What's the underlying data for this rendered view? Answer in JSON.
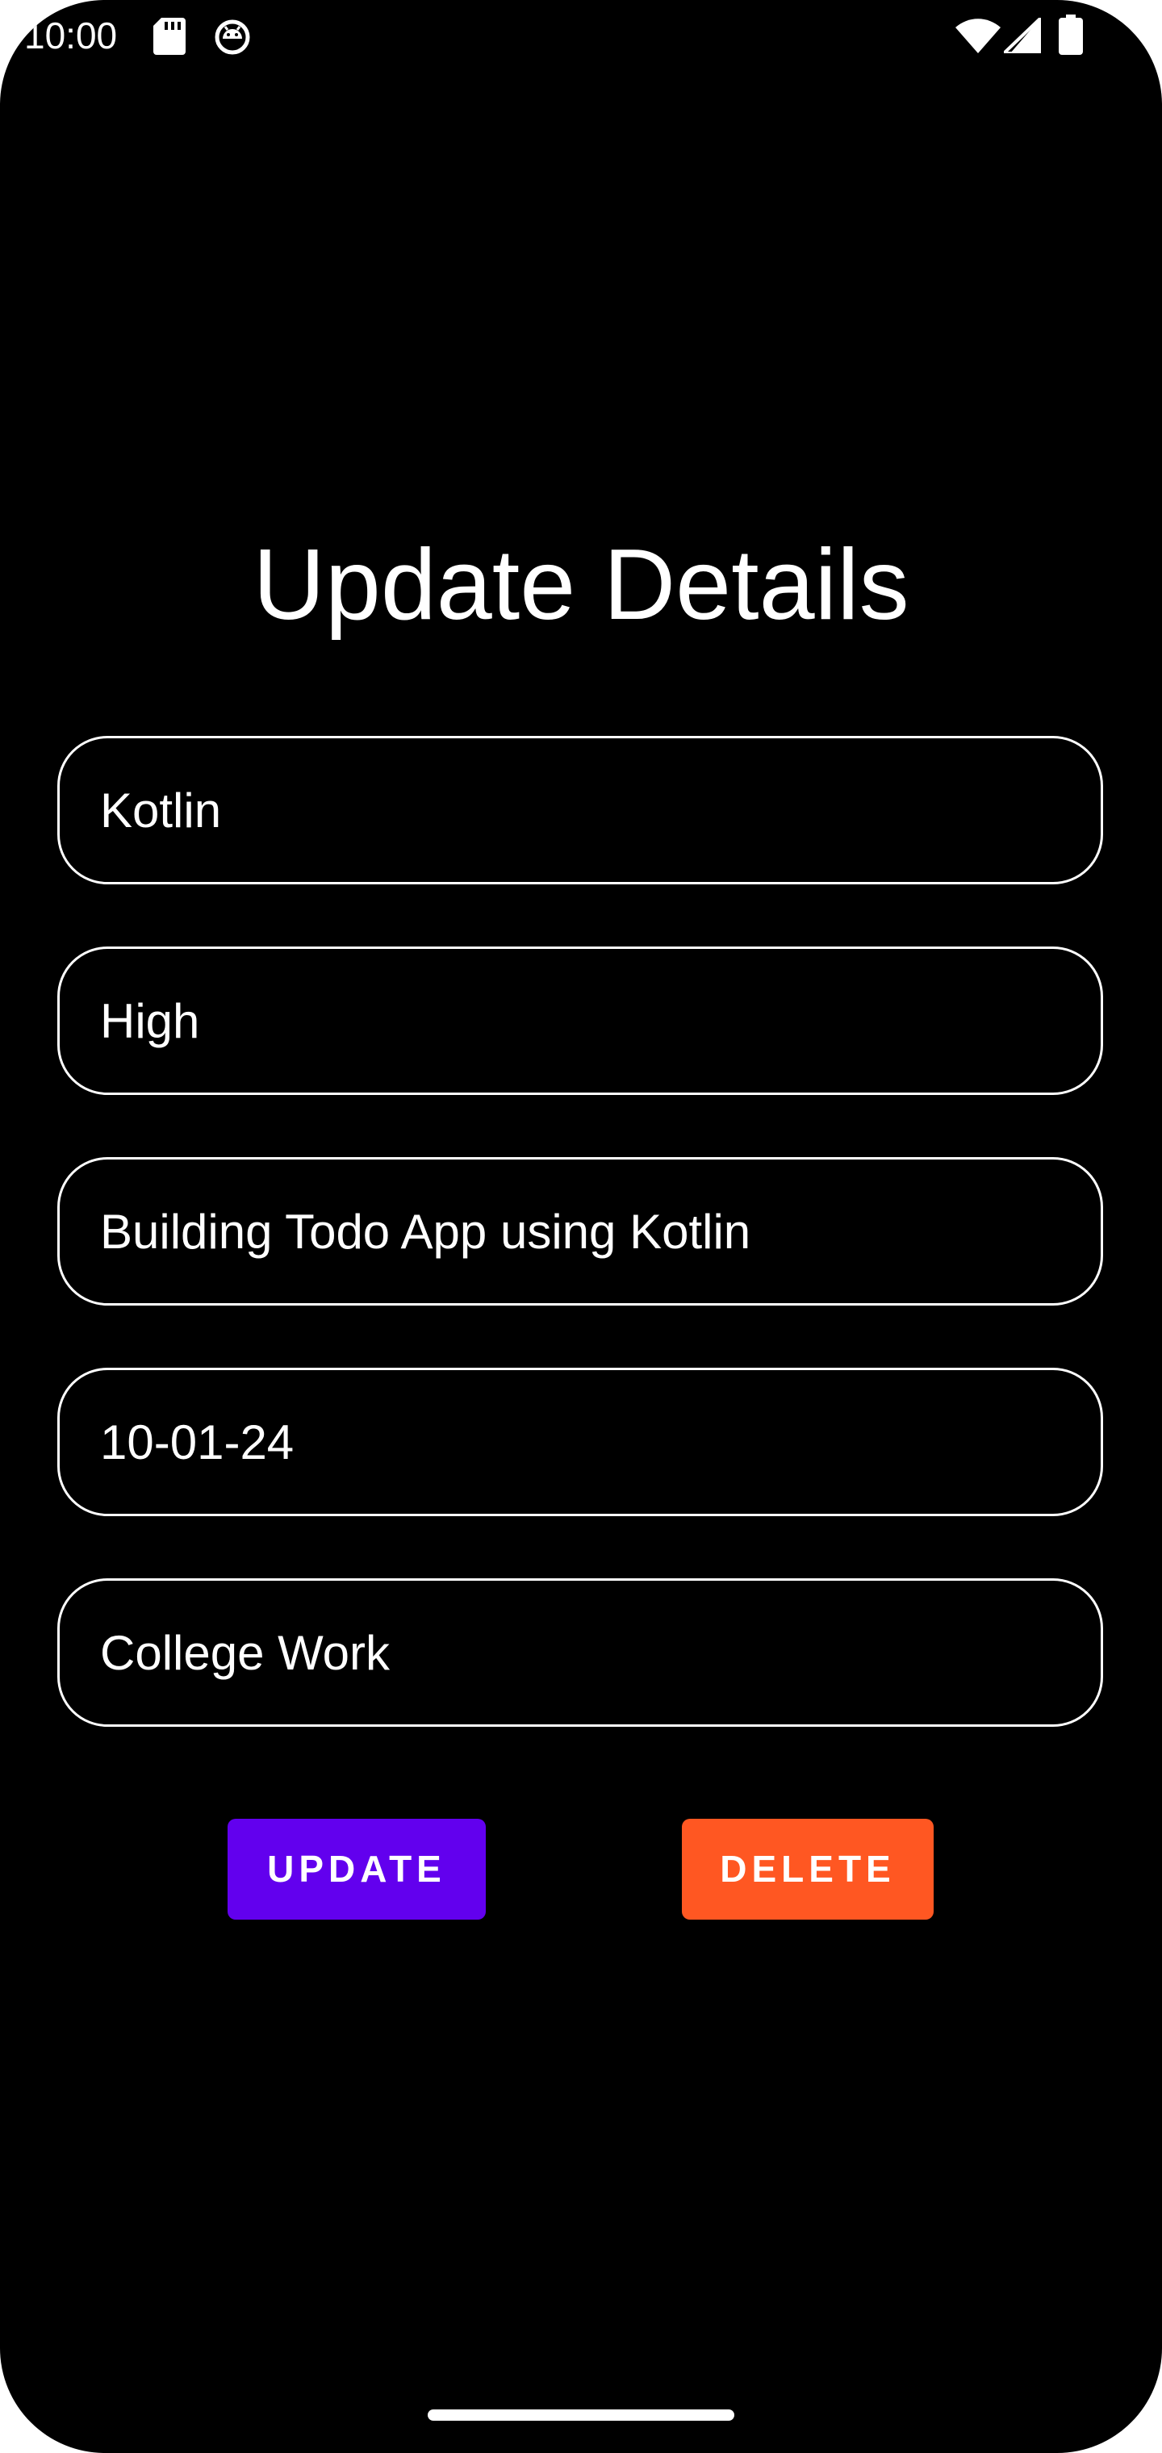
{
  "status_bar": {
    "time": "10:00",
    "left_icons": [
      "sd-card-icon",
      "android-debug-icon"
    ],
    "right_icons": [
      "wifi-icon",
      "cell-signal-icon",
      "battery-icon"
    ]
  },
  "page": {
    "title": "Update Details"
  },
  "form": {
    "fields": [
      {
        "name": "title",
        "value": "Kotlin"
      },
      {
        "name": "priority",
        "value": "High"
      },
      {
        "name": "description",
        "value": "Building Todo App using Kotlin"
      },
      {
        "name": "date",
        "value": "10-01-24"
      },
      {
        "name": "category",
        "value": "College Work"
      }
    ]
  },
  "actions": {
    "update_label": "UPDATE",
    "delete_label": "DELETE"
  },
  "colors": {
    "background": "#000000",
    "text": "#ffffff",
    "update_button": "#6200EE",
    "delete_button": "#FF5722"
  }
}
